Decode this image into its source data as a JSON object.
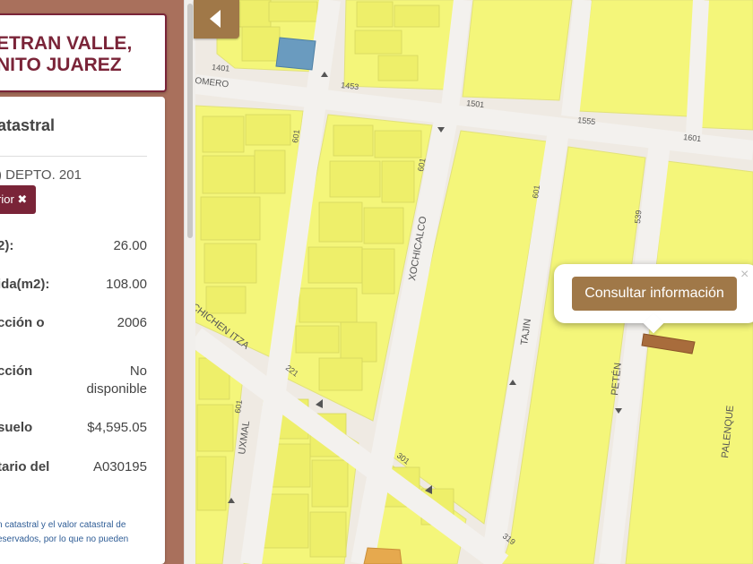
{
  "title_card": {
    "line1": "ETRAN VALLE,",
    "line2": "NITO JUAREZ"
  },
  "info_panel": {
    "heading": "atastral",
    "account": ") DEPTO. 201",
    "prev_button": "rior",
    "close_glyph": "✖",
    "rows": [
      {
        "label": "2):",
        "value": "26.00"
      },
      {
        "label": "ida(m2):",
        "value": "108.00"
      },
      {
        "label": "cción o",
        "value": "2006"
      },
      {
        "label": "cción",
        "value": "No disponible"
      },
      {
        "label": "suelo",
        "value": "$4,595.05"
      },
      {
        "label": "tario del",
        "value": "A030195"
      }
    ],
    "note_line1": "n catastral y el valor catastral de",
    "note_line2": "eservados, por lo que no pueden"
  },
  "map": {
    "streets": {
      "romero": "ROMERO",
      "xochicalco": "XOCHICALCO",
      "chichen_itza": "CHICHEN ITZA",
      "uxmal": "UXMAL",
      "tajin": "TAJIN",
      "peten": "PETÉN",
      "palenque": "PALENQUE"
    },
    "house_numbers": [
      "1401",
      "1453",
      "1501",
      "1555",
      "1601",
      "601",
      "601",
      "601",
      "539",
      "221",
      "301",
      "319",
      "601"
    ],
    "colors": {
      "block": "#f4f67a",
      "building": "#eeef6a",
      "street": "#f3f1ee",
      "selected_parcel": "#a86c3c",
      "blue_parcel": "#6a9bbf",
      "orange_parcel": "#e6a94e"
    }
  },
  "back_button": {
    "icon": "chevron-left-icon"
  },
  "popup": {
    "button_label": "Consultar información",
    "close_label": "×"
  }
}
